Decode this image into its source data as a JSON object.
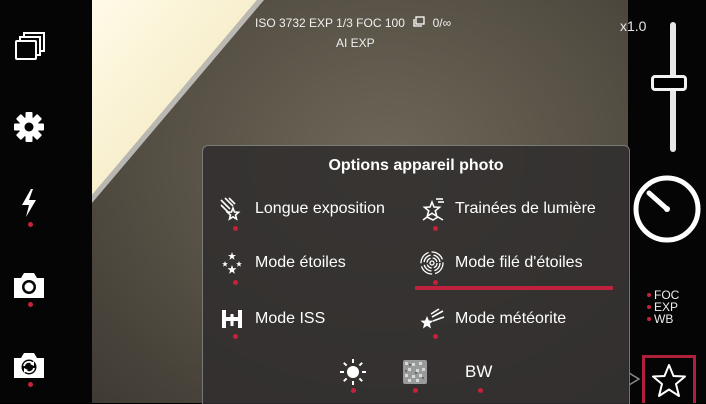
{
  "hud": {
    "line1": "ISO 3732 EXP 1/3 FOC 100",
    "counter": "0/∞",
    "line2": "AI EXP"
  },
  "zoom": "x1.0",
  "right_labels": {
    "foc": "FOC",
    "exp": "EXP",
    "wb": "WB"
  },
  "panel": {
    "title": "Options appareil photo",
    "options": [
      {
        "label": "Longue exposition",
        "icon": "comet-icon"
      },
      {
        "label": "Trainées de lumière",
        "icon": "star-trail-icon"
      },
      {
        "label": "Mode étoiles",
        "icon": "stars-icon"
      },
      {
        "label": "Mode filé d'étoiles",
        "icon": "star-spiral-icon",
        "selected": true
      },
      {
        "label": "Mode ISS",
        "icon": "iss-icon"
      },
      {
        "label": "Mode météorite",
        "icon": "meteor-icon"
      }
    ],
    "bottom_bw": "BW"
  },
  "colors": {
    "accent": "#c0213d",
    "bar": "#050505"
  }
}
